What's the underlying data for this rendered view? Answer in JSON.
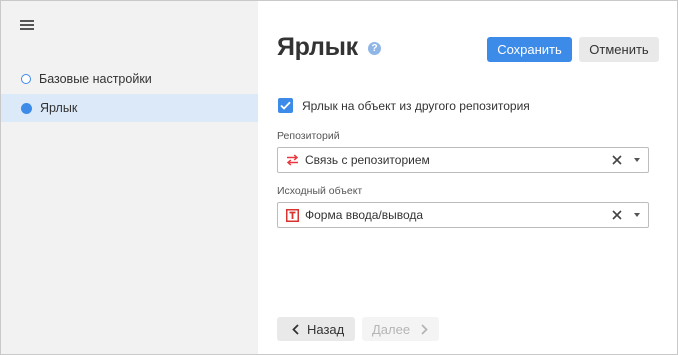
{
  "sidebar": {
    "menu_icon": "hamburger-menu-icon",
    "steps": [
      {
        "label": "Базовые настройки",
        "state": "pending"
      },
      {
        "label": "Ярлык",
        "state": "active"
      }
    ]
  },
  "header": {
    "title": "Ярлык",
    "help_icon": "question-mark-icon",
    "help_glyph": "?",
    "save_label": "Сохранить",
    "cancel_label": "Отменить"
  },
  "form": {
    "checkbox": {
      "label": "Ярлык на объект из другого репозитория",
      "checked": true
    },
    "repository": {
      "label": "Репозиторий",
      "value": "Связь с репозиторием",
      "icon": "repository-link-icon"
    },
    "source_object": {
      "label": "Исходный объект",
      "value": "Форма ввода/вывода",
      "icon": "form-io-icon"
    }
  },
  "footer": {
    "back_label": "Назад",
    "next_label": "Далее",
    "next_enabled": false
  },
  "colors": {
    "accent": "#3d8be8",
    "sidebar_bg": "#f2f2f2",
    "active_step_bg": "#dce9f9",
    "repo_icon": "#e8373f",
    "form_icon": "#d8332f"
  }
}
